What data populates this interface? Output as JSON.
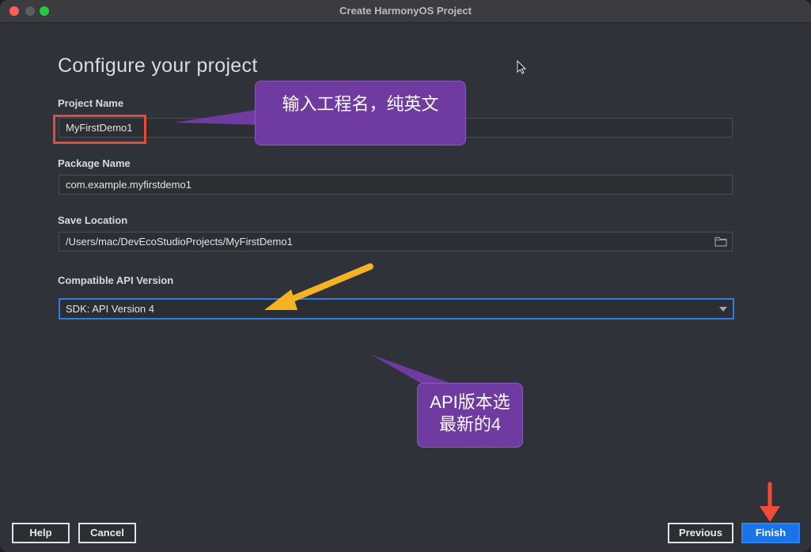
{
  "window": {
    "title": "Create HarmonyOS Project"
  },
  "heading": "Configure your project",
  "fields": {
    "project_name": {
      "label": "Project Name",
      "value": "MyFirstDemo1"
    },
    "package_name": {
      "label": "Package Name",
      "value": "com.example.myfirstdemo1"
    },
    "save_location": {
      "label": "Save Location",
      "value": "/Users/mac/DevEcoStudioProjects/MyFirstDemo1"
    },
    "api_version": {
      "label": "Compatible API Version",
      "value": "SDK: API Version 4"
    }
  },
  "annotations": {
    "callout_name": "输入工程名，纯英文",
    "callout_api_line1": "API版本选",
    "callout_api_line2": "最新的4"
  },
  "buttons": {
    "help": "Help",
    "cancel": "Cancel",
    "previous": "Previous",
    "finish": "Finish"
  },
  "colors": {
    "accent": "#1b73e8",
    "callout": "#6f3ba0",
    "highlight": "#e64a3b",
    "arrow_yellow": "#f5b324",
    "arrow_red": "#f04a3a"
  },
  "icons": [
    "folder-icon",
    "dropdown-arrow-icon",
    "mouse-cursor-icon"
  ]
}
